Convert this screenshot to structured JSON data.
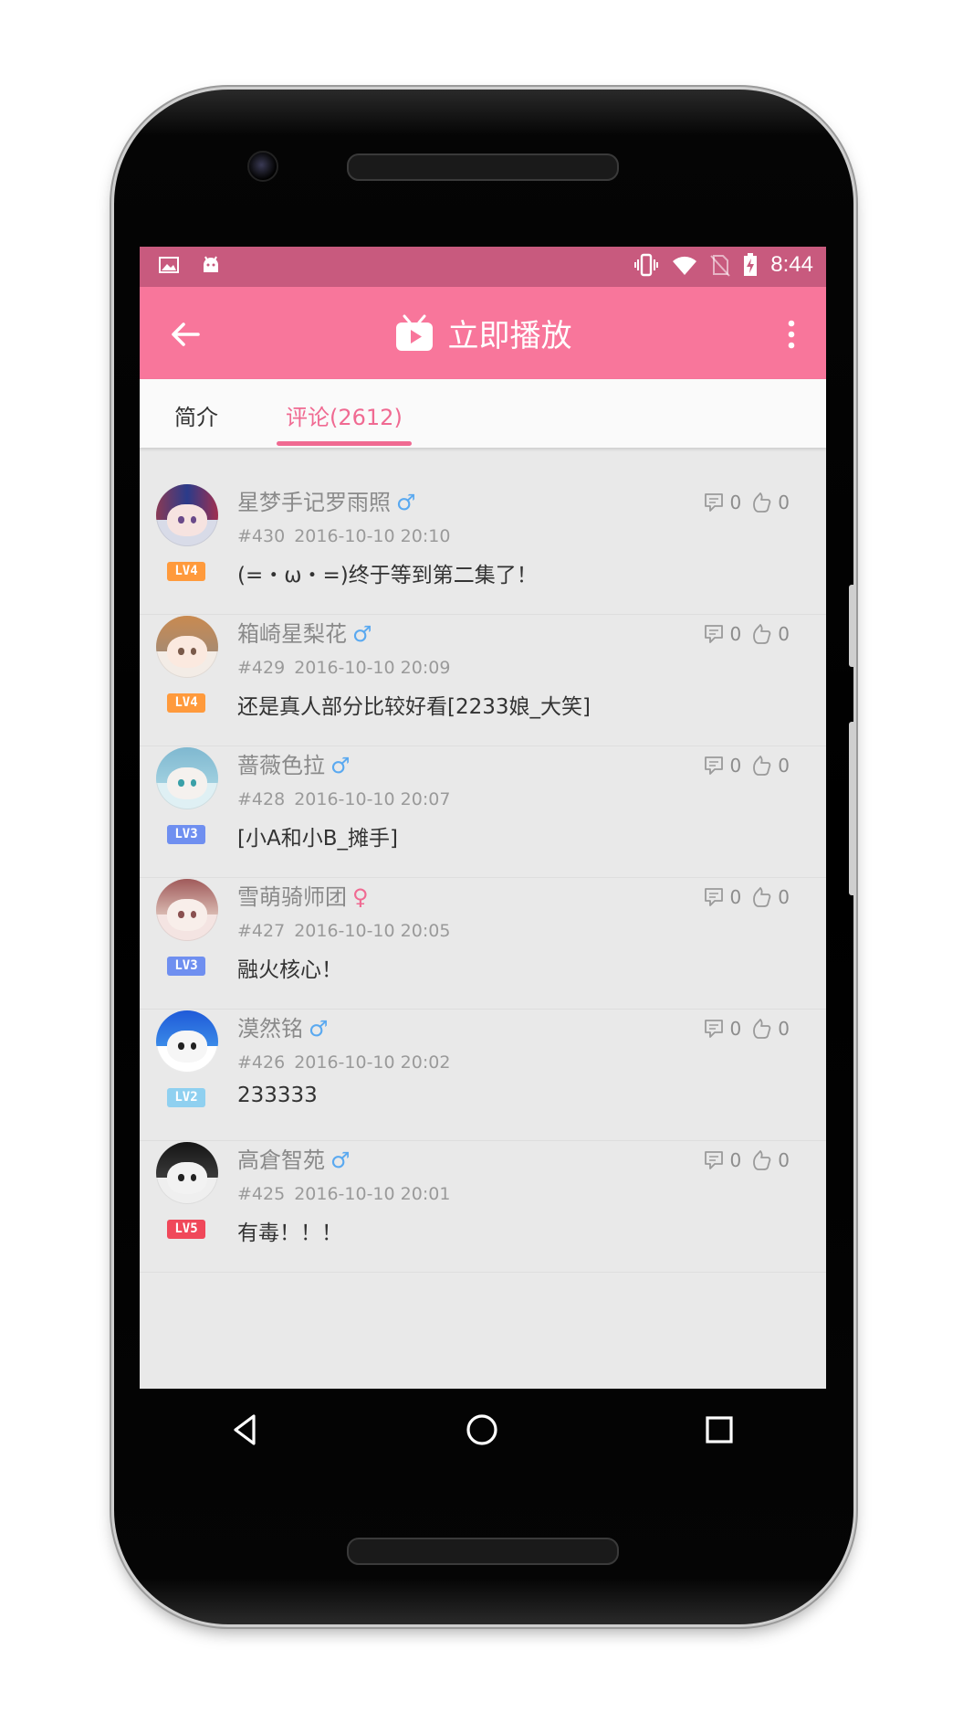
{
  "status_bar": {
    "left_icons": [
      "image-icon",
      "android-icon"
    ],
    "right_icons": [
      "vibrate-icon",
      "wifi-icon",
      "no-sim-icon",
      "battery-charging-icon"
    ],
    "time": "8:44"
  },
  "toolbar": {
    "title": "立即播放",
    "back_icon": "arrow-left-icon",
    "title_icon": "tv-play-icon",
    "more_icon": "more-vertical-icon"
  },
  "tabs": [
    {
      "label": "简介",
      "selected": false
    },
    {
      "label": "评论(2612)",
      "selected": true
    }
  ],
  "comments": [
    {
      "name": "星梦手记罗雨照",
      "gender": "♂",
      "floor": "#430",
      "time": "2016-10-10 20:10",
      "content": "(=・ω・=)终于等到第二集了！",
      "level": "LV4",
      "replies": "0",
      "likes": "0"
    },
    {
      "name": "箱崎星梨花",
      "gender": "♂",
      "floor": "#429",
      "time": "2016-10-10 20:09",
      "content": "还是真人部分比较好看[2233娘_大笑]",
      "level": "LV4",
      "replies": "0",
      "likes": "0"
    },
    {
      "name": "蔷薇色拉",
      "gender": "♂",
      "floor": "#428",
      "time": "2016-10-10 20:07",
      "content": "[小A和小B_摊手]",
      "level": "LV3",
      "replies": "0",
      "likes": "0"
    },
    {
      "name": "雪萌骑师团",
      "gender": "♀",
      "floor": "#427",
      "time": "2016-10-10 20:05",
      "content": "融火核心！",
      "level": "LV3",
      "replies": "0",
      "likes": "0"
    },
    {
      "name": "漠然铭",
      "gender": "♂",
      "floor": "#426",
      "time": "2016-10-10 20:02",
      "content": "233333",
      "level": "LV2",
      "replies": "0",
      "likes": "0"
    },
    {
      "name": "高倉智苑",
      "gender": "♂",
      "floor": "#425",
      "time": "2016-10-10 20:01",
      "content": "有毒！！！",
      "level": "LV5",
      "replies": "0",
      "likes": "0"
    }
  ],
  "colors": {
    "status_bar": "#c85a7e",
    "toolbar": "#f8769b",
    "accent": "#f06a92",
    "male": "#5aa9f0",
    "female": "#f06a92",
    "level_colors": {
      "LV2": "#8fd0f0",
      "LV3": "#6f8ff0",
      "LV4": "#ff9a3c",
      "LV5": "#f0485a"
    }
  },
  "nav_bar": [
    "back-triangle-icon",
    "home-circle-icon",
    "recents-square-icon"
  ]
}
